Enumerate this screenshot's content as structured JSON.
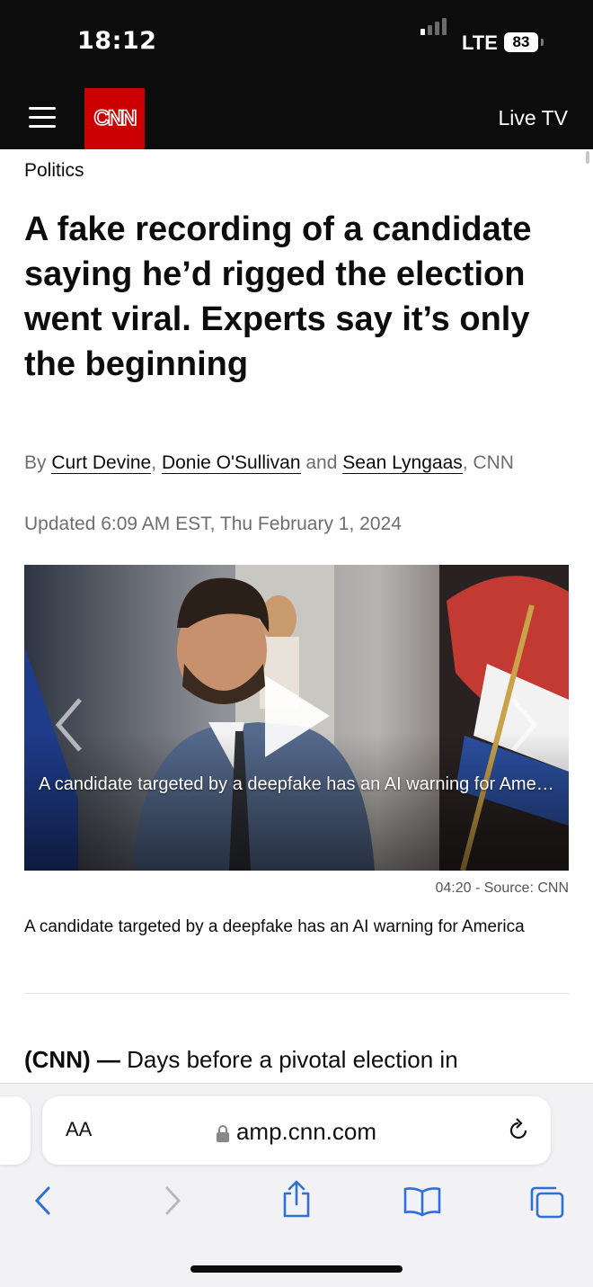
{
  "status_bar": {
    "time": "18:12",
    "network": "LTE",
    "battery": "83"
  },
  "header": {
    "logo": "CNN",
    "live_tv": "Live TV",
    "menu_icon": "hamburger-menu-icon"
  },
  "article": {
    "section": "Politics",
    "headline": "A fake recording of a candidate saying he’d rigged the election went viral. Experts say it’s only the beginning",
    "byline_prefix": "By",
    "authors": [
      "Curt Devine",
      "Donie O'Sullivan",
      "Sean Lyngaas"
    ],
    "byline_comma1": ",",
    "byline_and": "and",
    "byline_suffix": ", CNN",
    "updated": "Updated 6:09 AM EST, Thu February 1, 2024"
  },
  "video": {
    "overlay_title": "A candidate targeted by a deepfake has an AI warning for America",
    "duration_source": "04:20 - Source: CNN",
    "caption": "A candidate targeted by a deepfake has an AI warning for America",
    "icons": [
      "play-icon",
      "chevron-left-icon",
      "chevron-right-icon"
    ]
  },
  "lede": {
    "dateline": "(CNN) —",
    "text": "Days before a pivotal election in"
  },
  "browser": {
    "text_size_label": "AA",
    "url": "amp.cnn.com",
    "icons": [
      "lock-icon",
      "reload-icon",
      "back-icon",
      "forward-icon",
      "share-icon",
      "bookmarks-icon",
      "tabs-icon"
    ]
  },
  "colors": {
    "cnn_red": "#cc0000",
    "header_bg": "#0c0c0c",
    "toolbar_blue": "#2f6fd6"
  }
}
